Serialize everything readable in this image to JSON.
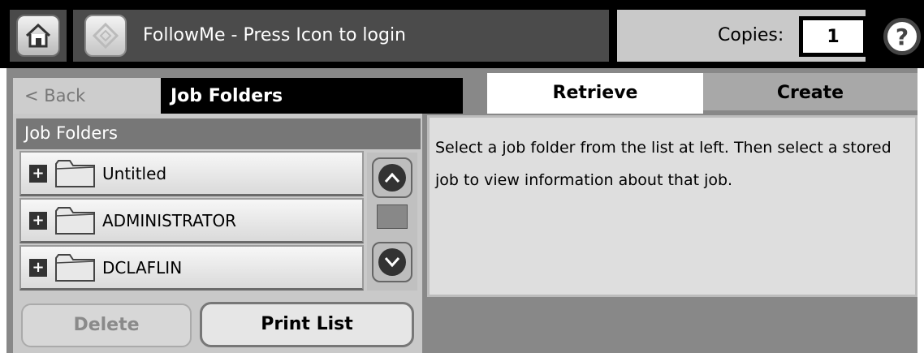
{
  "header": {
    "home_icon": "home-icon",
    "login_icon": "login-diamond-icon",
    "login_text": "FollowMe - Press Icon to login",
    "copies_label": "Copies:",
    "copies_value": "1",
    "help_icon": "help-icon"
  },
  "nav": {
    "back_label": "< Back",
    "title": "Job Folders"
  },
  "tabs": [
    {
      "label": "Retrieve",
      "active": true
    },
    {
      "label": "Create",
      "active": false
    }
  ],
  "list": {
    "header": "Job Folders",
    "items": [
      {
        "label": "Untitled"
      },
      {
        "label": "ADMINISTRATOR"
      },
      {
        "label": "DCLAFLIN"
      }
    ]
  },
  "info": {
    "text": "Select a job folder from the list at left.  Then select a stored job to view information about that job."
  },
  "buttons": {
    "delete": "Delete",
    "print_list": "Print List"
  }
}
